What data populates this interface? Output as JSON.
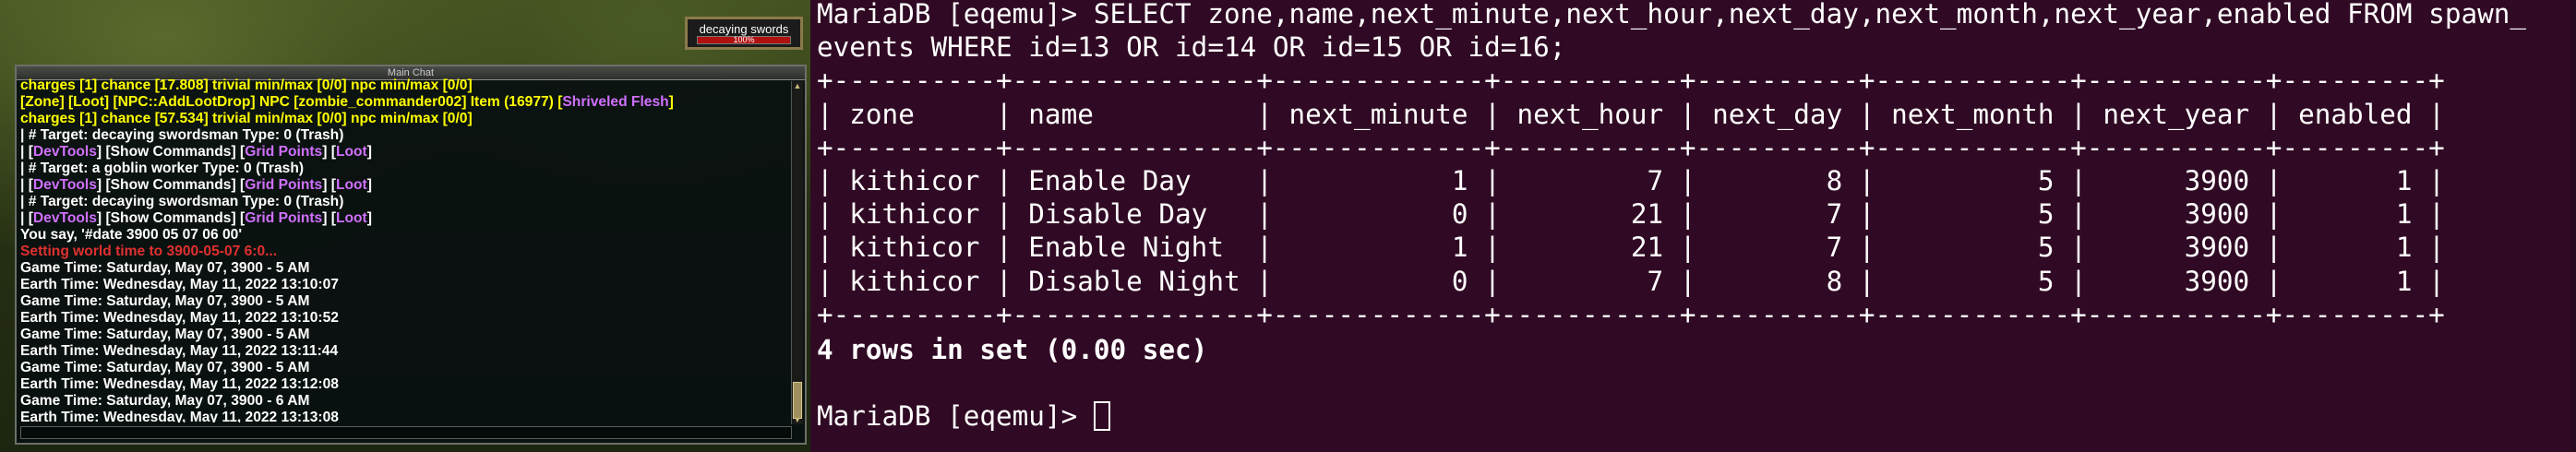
{
  "game": {
    "target": {
      "name": "decaying swords",
      "hp_text": "100%",
      "hp_fraction": 1.0
    },
    "chat": {
      "title": "Main Chat",
      "lines": [
        [
          {
            "t": "charges [1] chance [17.808] trivial min/max [0/0] npc min/max [0/0]",
            "c": "yellow"
          }
        ],
        [
          {
            "t": "[Zone] [Loot] [NPC::AddLootDrop] NPC [zombie_commander002] Item (16977) [",
            "c": "yellow"
          },
          {
            "t": "Shriveled Flesh",
            "c": "purple"
          },
          {
            "t": "]",
            "c": "yellow"
          }
        ],
        [
          {
            "t": "charges [1] chance [57.534] trivial min/max [0/0] npc min/max [0/0]",
            "c": "yellow"
          }
        ],
        [
          {
            "t": "| # Target: decaying swordsman Type: 0 (Trash)",
            "c": "white"
          }
        ],
        [
          {
            "t": "| [",
            "c": "white"
          },
          {
            "t": "DevTools",
            "c": "purple"
          },
          {
            "t": "] [Show Commands] [",
            "c": "white"
          },
          {
            "t": "Grid Points",
            "c": "purple"
          },
          {
            "t": "] [",
            "c": "white"
          },
          {
            "t": "Loot",
            "c": "purple"
          },
          {
            "t": "]",
            "c": "white"
          }
        ],
        [
          {
            "t": "| # Target: a goblin worker Type: 0 (Trash)",
            "c": "white"
          }
        ],
        [
          {
            "t": "| [",
            "c": "white"
          },
          {
            "t": "DevTools",
            "c": "purple"
          },
          {
            "t": "] [Show Commands] [",
            "c": "white"
          },
          {
            "t": "Grid Points",
            "c": "purple"
          },
          {
            "t": "] [",
            "c": "white"
          },
          {
            "t": "Loot",
            "c": "purple"
          },
          {
            "t": "]",
            "c": "white"
          }
        ],
        [
          {
            "t": "| # Target: decaying swordsman Type: 0 (Trash)",
            "c": "white"
          }
        ],
        [
          {
            "t": "| [",
            "c": "white"
          },
          {
            "t": "DevTools",
            "c": "purple"
          },
          {
            "t": "] [Show Commands] [",
            "c": "white"
          },
          {
            "t": "Grid Points",
            "c": "purple"
          },
          {
            "t": "] [",
            "c": "white"
          },
          {
            "t": "Loot",
            "c": "purple"
          },
          {
            "t": "]",
            "c": "white"
          }
        ],
        [
          {
            "t": "You say, '#date 3900 05 07 06 00'",
            "c": "white"
          }
        ],
        [
          {
            "t": "Setting world time to 3900-05-07 6:0...",
            "c": "red"
          }
        ],
        [
          {
            "t": "Game Time: Saturday, May 07, 3900 - 5 AM",
            "c": "white"
          }
        ],
        [
          {
            "t": "Earth Time: Wednesday, May 11, 2022 13:10:07",
            "c": "white"
          }
        ],
        [
          {
            "t": "Game Time: Saturday, May 07, 3900 - 5 AM",
            "c": "white"
          }
        ],
        [
          {
            "t": "Earth Time: Wednesday, May 11, 2022 13:10:52",
            "c": "white"
          }
        ],
        [
          {
            "t": "Game Time: Saturday, May 07, 3900 - 5 AM",
            "c": "white"
          }
        ],
        [
          {
            "t": "Earth Time: Wednesday, May 11, 2022 13:11:44",
            "c": "white"
          }
        ],
        [
          {
            "t": "Game Time: Saturday, May 07, 3900 - 5 AM",
            "c": "white"
          }
        ],
        [
          {
            "t": "Earth Time: Wednesday, May 11, 2022 13:12:08",
            "c": "white"
          }
        ],
        [
          {
            "t": "Game Time: Saturday, May 07, 3900 - 6 AM",
            "c": "white"
          }
        ],
        [
          {
            "t": "Earth Time: Wednesday, May 11, 2022 13:13:08",
            "c": "white"
          }
        ]
      ]
    }
  },
  "terminal": {
    "lines": [
      {
        "t": "MariaDB [eqemu]> SELECT zone,name,next_minute,next_hour,next_day,next_month,next_year,enabled FROM spawn_",
        "bold": false
      },
      {
        "t": "events WHERE id=13 OR id=14 OR id=15 OR id=16;",
        "bold": false
      },
      {
        "t": "+----------+---------------+-------------+-----------+----------+------------+-----------+---------+",
        "bold": false
      },
      {
        "t": "| zone     | name          | next_minute | next_hour | next_day | next_month | next_year | enabled |",
        "bold": false
      },
      {
        "t": "+----------+---------------+-------------+-----------+----------+------------+-----------+---------+",
        "bold": false
      },
      {
        "t": "| kithicor | Enable Day    |           1 |         7 |        8 |          5 |      3900 |       1 |",
        "bold": false
      },
      {
        "t": "| kithicor | Disable Day   |           0 |        21 |        7 |          5 |      3900 |       1 |",
        "bold": false
      },
      {
        "t": "| kithicor | Enable Night  |           1 |        21 |        7 |          5 |      3900 |       1 |",
        "bold": false
      },
      {
        "t": "| kithicor | Disable Night |           0 |         7 |        8 |          5 |      3900 |       1 |",
        "bold": false
      },
      {
        "t": "+----------+---------------+-------------+-----------+----------+------------+-----------+---------+",
        "bold": false
      },
      {
        "t": "4 rows in set (0.00 sec)",
        "bold": true
      },
      {
        "t": "",
        "bold": false
      },
      {
        "t": "MariaDB [eqemu]> ",
        "bold": false
      }
    ]
  },
  "colors": {
    "terminal_bg": "#300a24",
    "chat_yellow": "#ffff00",
    "chat_white": "#ffffff",
    "chat_red": "#e03030",
    "chat_purple": "#d070ff"
  }
}
